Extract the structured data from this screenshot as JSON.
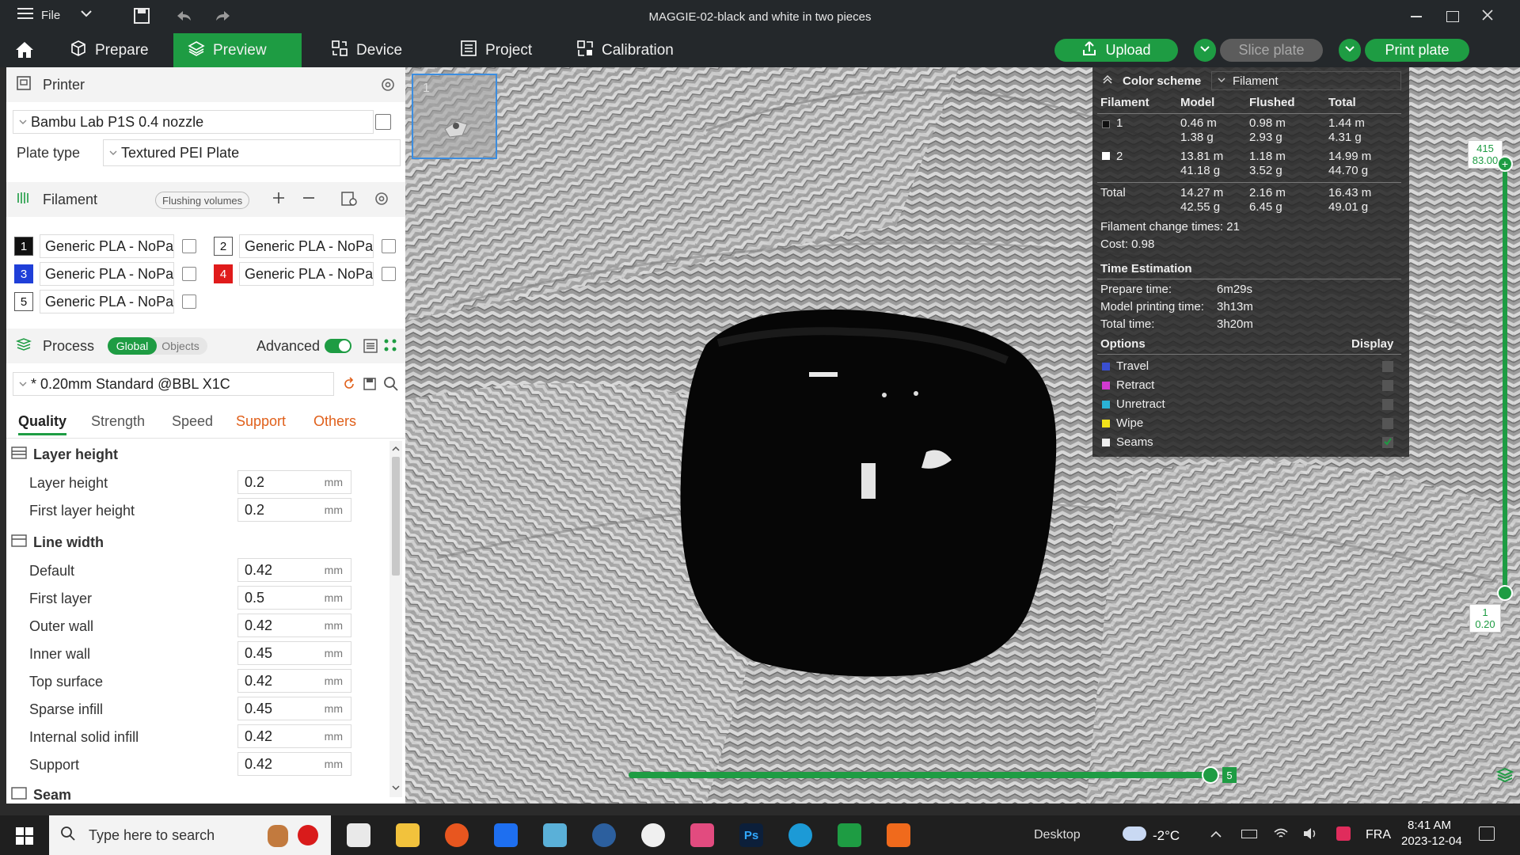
{
  "window": {
    "menu_label": "File",
    "title": "MAGGIE-02-black and white in two pieces"
  },
  "nav": {
    "tabs": [
      {
        "label": "Prepare",
        "icon": "cube-icon"
      },
      {
        "label": "Preview",
        "icon": "layers-icon"
      },
      {
        "label": "Device",
        "icon": "device-icon"
      },
      {
        "label": "Project",
        "icon": "project-icon"
      },
      {
        "label": "Calibration",
        "icon": "calibration-icon"
      }
    ],
    "active_tab": "Preview",
    "upload_label": "Upload",
    "slice_label": "Slice plate",
    "print_label": "Print plate",
    "accent_color": "#1e9c43"
  },
  "printer": {
    "section_label": "Printer",
    "name": "Bambu Lab P1S 0.4 nozzle",
    "plate_type_label": "Plate type",
    "plate_type": "Textured PEI Plate"
  },
  "filament": {
    "section_label": "Filament",
    "flushing_label": "Flushing volumes",
    "items": [
      {
        "num": "1",
        "name": "Generic PLA - NoPa...",
        "color": "#111111",
        "text_color": "#ffffff"
      },
      {
        "num": "2",
        "name": "Generic PLA - NoPa...",
        "color": "#ffffff",
        "text_color": "#111111"
      },
      {
        "num": "3",
        "name": "Generic PLA - NoPa...",
        "color": "#1f3fd8",
        "text_color": "#ffffff"
      },
      {
        "num": "4",
        "name": "Generic PLA - NoPa...",
        "color": "#e01b1b",
        "text_color": "#ffffff"
      },
      {
        "num": "5",
        "name": "Generic PLA - NoPa...",
        "color": "#ffffff",
        "text_color": "#111111"
      }
    ]
  },
  "process": {
    "section_label": "Process",
    "global_label": "Global",
    "objects_label": "Objects",
    "advanced_label": "Advanced",
    "advanced_on": true,
    "profile": "* 0.20mm Standard @BBL X1C",
    "tabs": [
      {
        "label": "Quality",
        "active": true,
        "color": "#222222"
      },
      {
        "label": "Strength",
        "active": false,
        "color": "#555555"
      },
      {
        "label": "Speed",
        "active": false,
        "color": "#555555"
      },
      {
        "label": "Support",
        "active": false,
        "color": "#e0601b"
      },
      {
        "label": "Others",
        "active": false,
        "color": "#e0601b"
      }
    ],
    "groups": {
      "layer_height": {
        "title": "Layer height",
        "params": [
          {
            "label": "Layer height",
            "value": "0.2",
            "unit": "mm"
          },
          {
            "label": "First layer height",
            "value": "0.2",
            "unit": "mm"
          }
        ]
      },
      "line_width": {
        "title": "Line width",
        "params": [
          {
            "label": "Default",
            "value": "0.42",
            "unit": "mm"
          },
          {
            "label": "First layer",
            "value": "0.5",
            "unit": "mm"
          },
          {
            "label": "Outer wall",
            "value": "0.42",
            "unit": "mm"
          },
          {
            "label": "Inner wall",
            "value": "0.45",
            "unit": "mm"
          },
          {
            "label": "Top surface",
            "value": "0.42",
            "unit": "mm"
          },
          {
            "label": "Sparse infill",
            "value": "0.45",
            "unit": "mm"
          },
          {
            "label": "Internal solid infill",
            "value": "0.42",
            "unit": "mm"
          },
          {
            "label": "Support",
            "value": "0.42",
            "unit": "mm"
          }
        ]
      },
      "seam": {
        "title": "Seam"
      }
    }
  },
  "viewport": {
    "plate_number": "1",
    "stats": {
      "color_scheme_label": "Color scheme",
      "color_scheme_value": "Filament",
      "headers": [
        "Filament",
        "Model",
        "Flushed",
        "Total"
      ],
      "rows": [
        {
          "id": "1",
          "swatch": "#111111",
          "model_m": "0.46 m",
          "model_g": "1.38 g",
          "flushed_m": "0.98 m",
          "flushed_g": "2.93 g",
          "total_m": "1.44 m",
          "total_g": "4.31 g"
        },
        {
          "id": "2",
          "swatch": "#ffffff",
          "model_m": "13.81 m",
          "model_g": "41.18 g",
          "flushed_m": "1.18 m",
          "flushed_g": "3.52 g",
          "total_m": "14.99 m",
          "total_g": "44.70 g"
        }
      ],
      "total_row": {
        "label": "Total",
        "model_m": "14.27 m",
        "model_g": "42.55 g",
        "flushed_m": "2.16 m",
        "flushed_g": "6.45 g",
        "total_m": "16.43 m",
        "total_g": "49.01 g"
      },
      "change_times": "Filament change times:  21",
      "cost": "Cost:  0.98",
      "time_title": "Time Estimation",
      "prepare_label": "Prepare time:",
      "prepare_value": "6m29s",
      "model_time_label": "Model printing time:",
      "model_time_value": "3h13m",
      "total_time_label": "Total time:",
      "total_time_value": "3h20m",
      "options_label": "Options",
      "display_label": "Display",
      "options": [
        {
          "label": "Travel",
          "color": "#3a4fd0",
          "checked": false
        },
        {
          "label": "Retract",
          "color": "#d23ad0",
          "checked": false
        },
        {
          "label": "Unretract",
          "color": "#2ab3d6",
          "checked": false
        },
        {
          "label": "Wipe",
          "color": "#f2e31b",
          "checked": false
        },
        {
          "label": "Seams",
          "color": "#eeeeee",
          "checked": true
        }
      ]
    },
    "layer_slider": {
      "top_layer": "415",
      "top_height": "83.00",
      "bottom_layer": "1",
      "bottom_height": "0.20"
    },
    "move_slider": {
      "value": "5"
    }
  },
  "taskbar": {
    "search_placeholder": "Type here to search",
    "desktop_label": "Desktop",
    "weather": "-2°C",
    "language": "FRA",
    "time": "8:41 AM",
    "date": "2023-12-04"
  }
}
